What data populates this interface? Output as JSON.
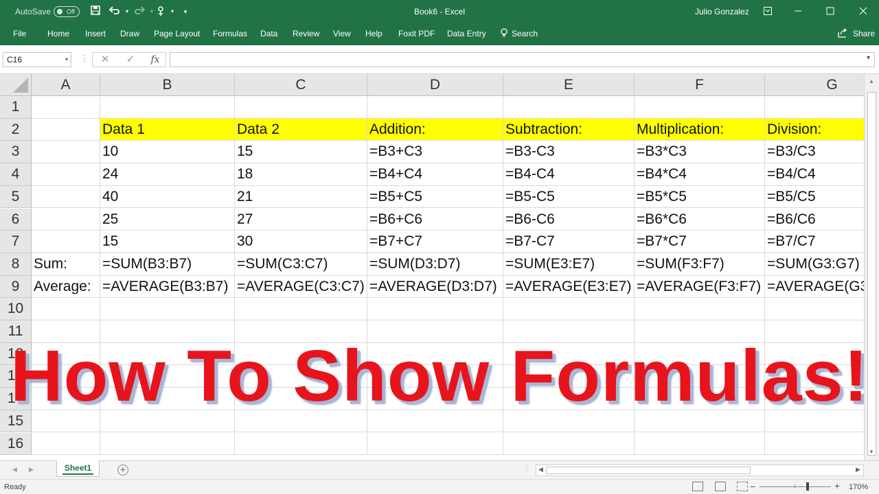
{
  "titlebar": {
    "autosave_label": "AutoSave",
    "autosave_state": "Off",
    "title": "Book6  -  Excel",
    "user": "Julio Gonzalez"
  },
  "ribbon": {
    "tabs": [
      "File",
      "Home",
      "Insert",
      "Draw",
      "Page Layout",
      "Formulas",
      "Data",
      "Review",
      "View",
      "Help",
      "Foxit PDF",
      "Data Entry"
    ],
    "search_label": "Search",
    "share_label": "Share"
  },
  "formula_bar": {
    "name_box": "C16",
    "formula": "",
    "fx_label": "fx"
  },
  "grid": {
    "columns": [
      "A",
      "B",
      "C",
      "D",
      "E",
      "F",
      "G"
    ],
    "rows": [
      "1",
      "2",
      "3",
      "4",
      "5",
      "6",
      "7",
      "8",
      "9",
      "10",
      "11",
      "12",
      "13",
      "14",
      "15",
      "16"
    ],
    "cells": [
      [
        "",
        "",
        "",
        "",
        "",
        "",
        ""
      ],
      [
        "",
        "Data 1",
        "Data 2",
        "Addition:",
        "Subtraction:",
        "Multiplication:",
        "Division:"
      ],
      [
        "",
        "10",
        "15",
        "=B3+C3",
        "=B3-C3",
        "=B3*C3",
        "=B3/C3"
      ],
      [
        "",
        "24",
        "18",
        "=B4+C4",
        "=B4-C4",
        "=B4*C4",
        "=B4/C4"
      ],
      [
        "",
        "40",
        "21",
        "=B5+C5",
        "=B5-C5",
        "=B5*C5",
        "=B5/C5"
      ],
      [
        "",
        "25",
        "27",
        "=B6+C6",
        "=B6-C6",
        "=B6*C6",
        "=B6/C6"
      ],
      [
        "",
        "15",
        "30",
        "=B7+C7",
        "=B7-C7",
        "=B7*C7",
        "=B7/C7"
      ],
      [
        "Sum:",
        "=SUM(B3:B7)",
        "=SUM(C3:C7)",
        "=SUM(D3:D7)",
        "=SUM(E3:E7)",
        "=SUM(F3:F7)",
        "=SUM(G3:G7)"
      ],
      [
        "Average:",
        "=AVERAGE(B3:B7)",
        "=AVERAGE(C3:C7)",
        "=AVERAGE(D3:D7)",
        "=AVERAGE(E3:E7)",
        "=AVERAGE(F3:F7)",
        "=AVERAGE(G3"
      ],
      [
        "",
        "",
        "",
        "",
        "",
        "",
        ""
      ],
      [
        "",
        "",
        "",
        "",
        "",
        "",
        ""
      ],
      [
        "",
        "",
        "",
        "",
        "",
        "",
        ""
      ],
      [
        "",
        "",
        "",
        "",
        "",
        "",
        ""
      ],
      [
        "",
        "",
        "",
        "",
        "",
        "",
        ""
      ],
      [
        "",
        "",
        "",
        "",
        "",
        "",
        ""
      ],
      [
        "",
        "",
        "",
        "",
        "",
        "",
        ""
      ]
    ],
    "highlight_color": "#ffff00"
  },
  "overlay_title": "How To Show Formulas!",
  "sheets": {
    "tabs": [
      "Sheet1"
    ],
    "active": "Sheet1"
  },
  "status": {
    "text": "Ready",
    "zoom": "170%"
  },
  "colors": {
    "excel_green": "#217346",
    "overlay_red": "#e8141b"
  }
}
